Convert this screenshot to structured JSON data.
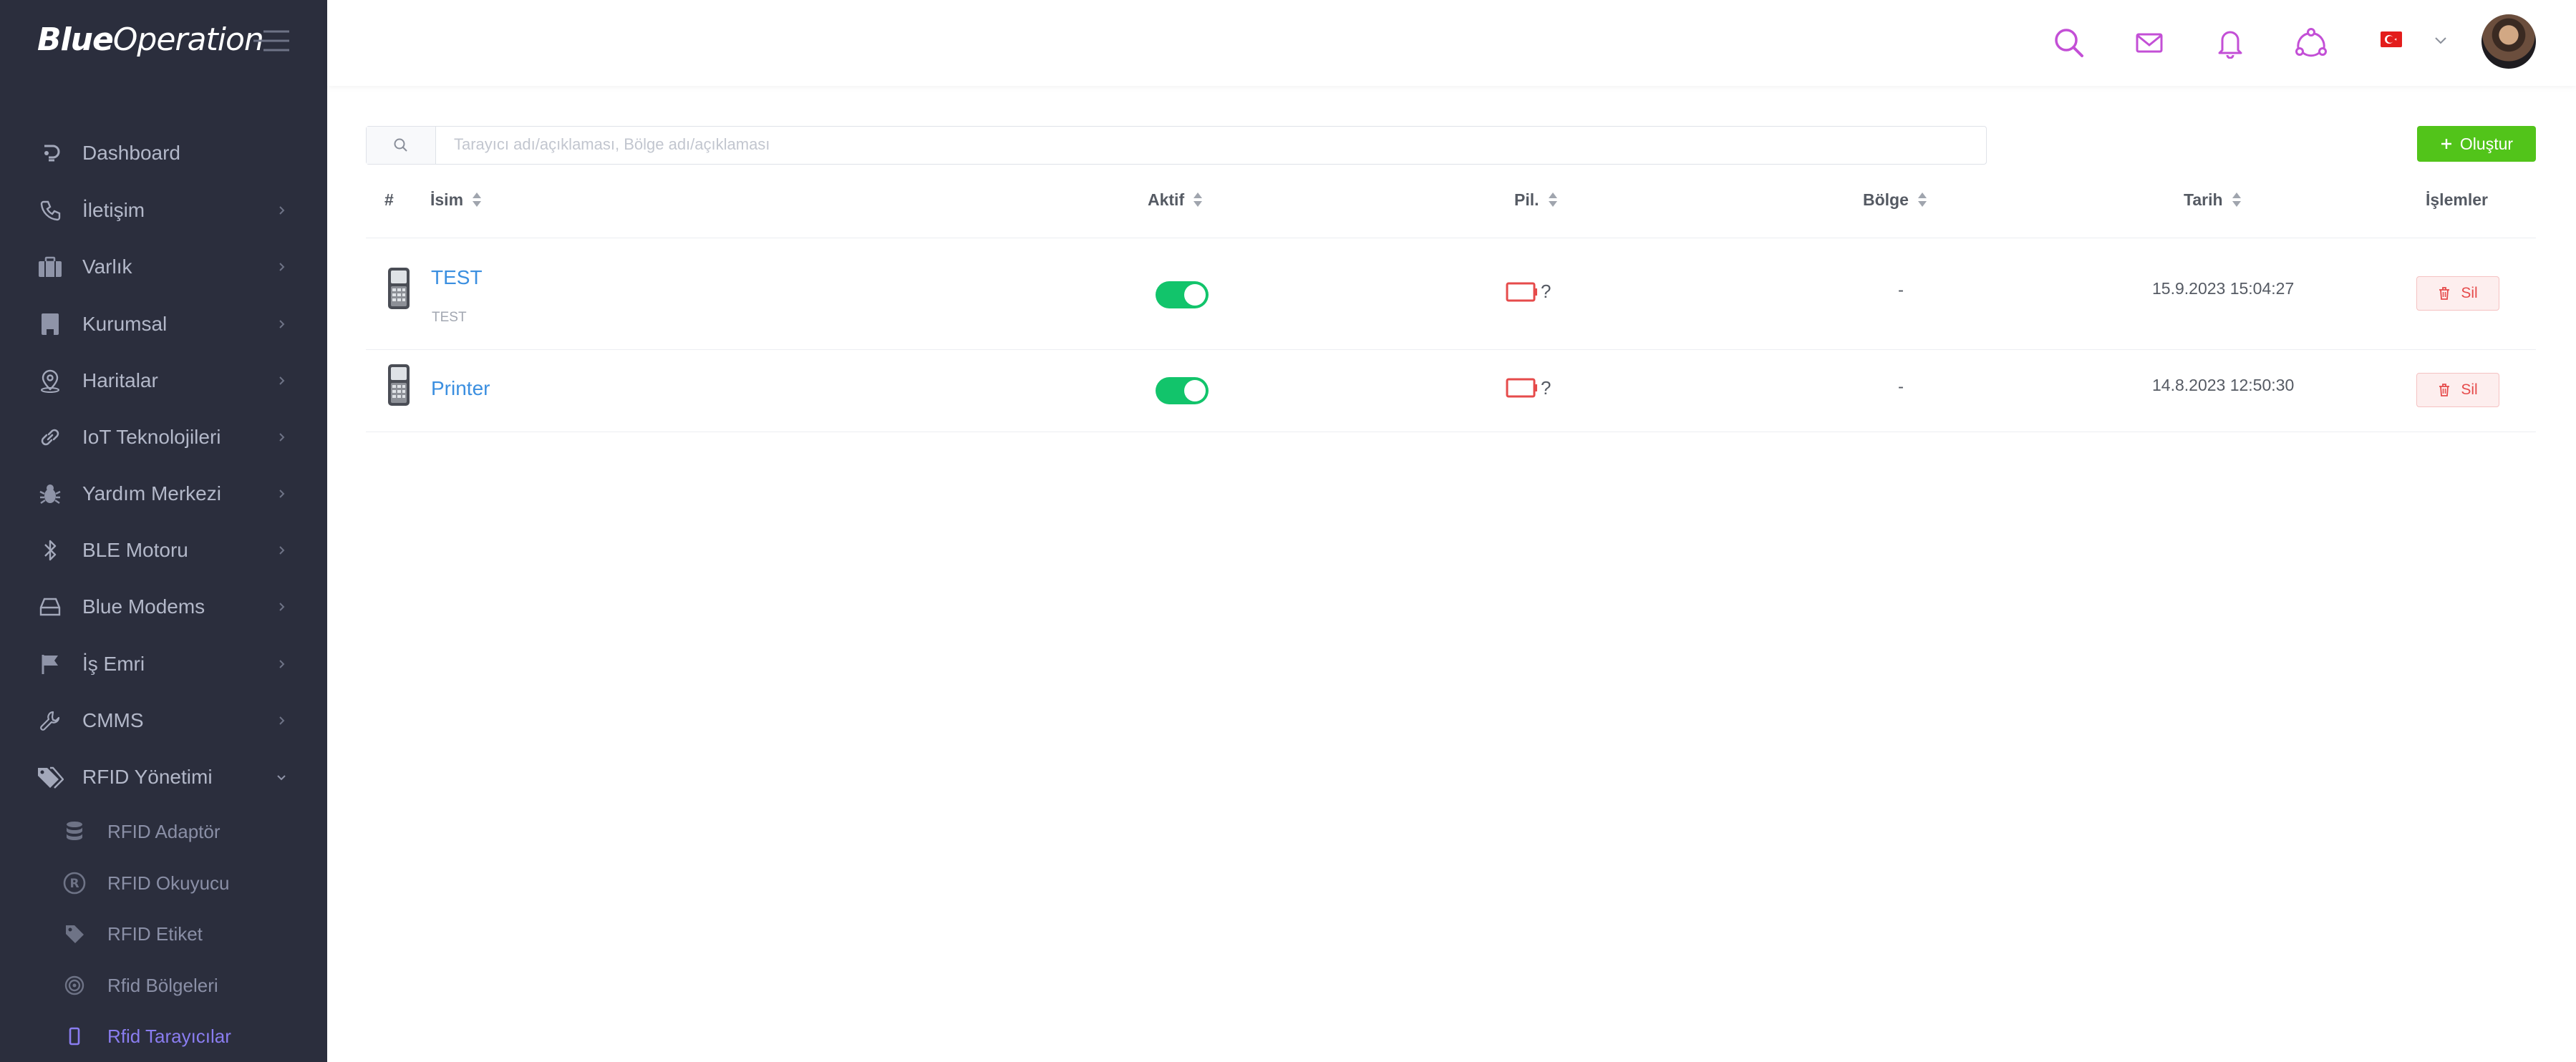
{
  "brand": {
    "bold": "Blue",
    "rest": "Operation"
  },
  "sidebar": {
    "items": [
      {
        "label": "Dashboard",
        "icon": "dashboard-icon"
      },
      {
        "label": "İletişim",
        "icon": "phone-icon"
      },
      {
        "label": "Varlık",
        "icon": "briefcase-icon"
      },
      {
        "label": "Kurumsal",
        "icon": "building-icon"
      },
      {
        "label": "Haritalar",
        "icon": "map-pin-icon"
      },
      {
        "label": "IoT Teknolojileri",
        "icon": "link-icon"
      },
      {
        "label": "Yardım Merkezi",
        "icon": "bug-icon"
      },
      {
        "label": "BLE Motoru",
        "icon": "bluetooth-icon"
      },
      {
        "label": "Blue Modems",
        "icon": "modem-icon"
      },
      {
        "label": "İş Emri",
        "icon": "flag-icon"
      },
      {
        "label": "CMMS",
        "icon": "wrench-icon"
      },
      {
        "label": "RFID Yönetimi",
        "icon": "tags-icon"
      }
    ],
    "subitems": [
      {
        "label": "RFID Adaptör",
        "icon": "database-icon"
      },
      {
        "label": "RFID Okuyucu",
        "icon": "registered-icon"
      },
      {
        "label": "RFID Etiket",
        "icon": "tag-icon"
      },
      {
        "label": "Rfid Bölgeleri",
        "icon": "target-icon"
      },
      {
        "label": "Rfid Tarayıcılar",
        "icon": "mobile-icon"
      }
    ]
  },
  "header": {
    "icons": [
      "search-icon",
      "mail-icon",
      "bell-icon",
      "share-icon"
    ],
    "language": "tr"
  },
  "search": {
    "placeholder": "Tarayıcı adı/açıklaması, Bölge adı/açıklaması",
    "value": ""
  },
  "create_label": "Oluştur",
  "table": {
    "headers": {
      "index": "#",
      "name": "İsim",
      "active": "Aktif",
      "battery": "Pil.",
      "region": "Bölge",
      "date": "Tarih",
      "actions": "İşlemler"
    },
    "rows": [
      {
        "name": "TEST",
        "description": "TEST",
        "active": true,
        "battery": "?",
        "region": "-",
        "date": "15.9.2023 15:04:27",
        "delete_label": "Sil"
      },
      {
        "name": "Printer",
        "description": "",
        "active": true,
        "battery": "?",
        "region": "-",
        "date": "14.8.2023 12:50:30",
        "delete_label": "Sil"
      }
    ]
  },
  "colors": {
    "sidebar_bg": "#2b2e3d",
    "accent_purple": "#8a7df0",
    "header_icon": "#c34fd6",
    "create_green": "#52c41a",
    "toggle_green": "#12c46b",
    "link_blue": "#3b8fe0",
    "danger_red": "#e64b4b"
  }
}
